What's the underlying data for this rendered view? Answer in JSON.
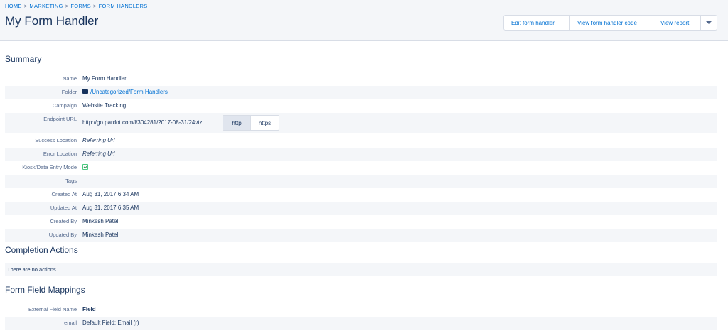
{
  "breadcrumb": {
    "items": [
      "HOME",
      "MARKETING",
      "FORMS",
      "FORM HANDLERS"
    ],
    "separator": ">"
  },
  "title": "My Form Handler",
  "actions": {
    "edit_label": "Edit form handler",
    "view_code_label": "View form handler code",
    "view_report_label": "View report"
  },
  "summary": {
    "title": "Summary",
    "name_label": "Name",
    "name_value": "My Form Handler",
    "folder_label": "Folder",
    "folder_value": "/Uncategorized/Form Handlers",
    "campaign_label": "Campaign",
    "campaign_value": "Website Tracking",
    "endpoint_label": "Endpoint URL",
    "endpoint_value": "http://go.pardot.com/l/304281/2017-08-31/24vtz",
    "protocol_http": "http",
    "protocol_https": "https",
    "protocol_selected": "http",
    "success_label": "Success Location",
    "success_value": "Referring Url",
    "error_label": "Error Location",
    "error_value": "Referring Url",
    "kiosk_label": "Kiosk/Data Entry Mode",
    "kiosk_checked": true,
    "tags_label": "Tags",
    "tags_value": "",
    "created_at_label": "Created At",
    "created_at_value": "Aug 31, 2017 6:34 AM",
    "updated_at_label": "Updated At",
    "updated_at_value": "Aug 31, 2017 6:35 AM",
    "created_by_label": "Created By",
    "created_by_value": "Minkesh Patel",
    "updated_by_label": "Updated By",
    "updated_by_value": "Minkesh Patel"
  },
  "completion": {
    "title": "Completion Actions",
    "empty_text": "There are no actions"
  },
  "mappings": {
    "title": "Form Field Mappings",
    "header_label": "External Field Name",
    "header_value": "Field",
    "rows": [
      {
        "label": "email",
        "value": "Default Field: Email (r)"
      }
    ]
  },
  "colors": {
    "link": "#0070d2",
    "text": "#16325c",
    "muted": "#54698d",
    "row_alt": "#f4f6f9",
    "check": "#4bca81"
  }
}
